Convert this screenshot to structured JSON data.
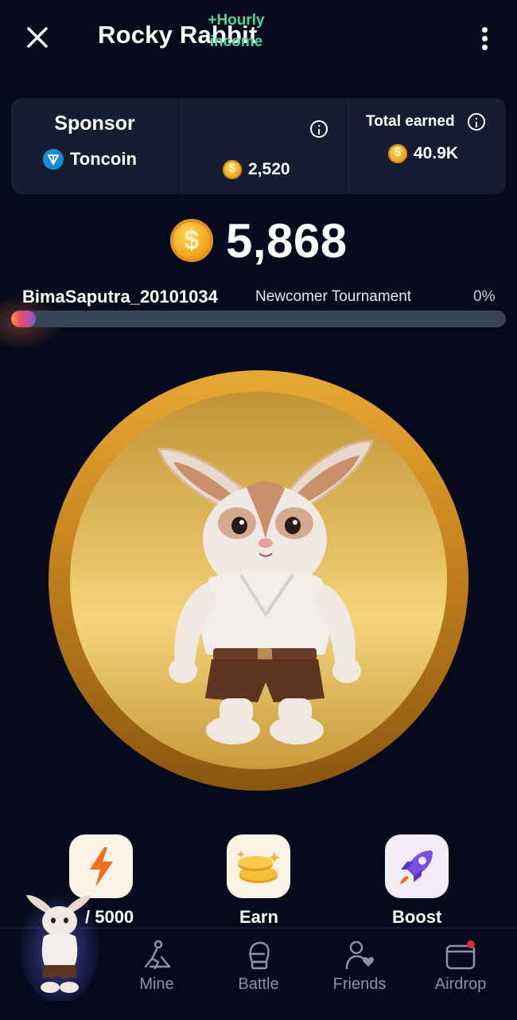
{
  "header": {
    "title": "Rocky Rabbit"
  },
  "stats": {
    "sponsor_title": "Sponsor",
    "sponsor_name": "Toncoin",
    "hourly_label": "+Hourly income",
    "hourly_value": "2,520",
    "total_label": "Total earned",
    "total_value": "40.9K"
  },
  "balance": "5,868",
  "progress": {
    "username": "BimaSaputra_20101034",
    "tournament": "Newcomer Tournament",
    "percent_label": "0%",
    "value": 0.05
  },
  "actions": [
    {
      "label": "/ 5000",
      "icon": "lightning-icon"
    },
    {
      "label": "Earn",
      "icon": "coins-icon"
    },
    {
      "label": "Boost",
      "icon": "rocket-icon"
    }
  ],
  "nav": [
    {
      "label": "Mine",
      "icon": "mine-icon"
    },
    {
      "label": "Battle",
      "icon": "boxing-glove-icon"
    },
    {
      "label": "Friends",
      "icon": "friends-icon"
    },
    {
      "label": "Airdrop",
      "icon": "wallet-icon"
    }
  ],
  "colors": {
    "background": "#060a1c",
    "card": "#141d31",
    "accent_green": "#4fd69c",
    "coin_gold": "#f0a21b"
  }
}
